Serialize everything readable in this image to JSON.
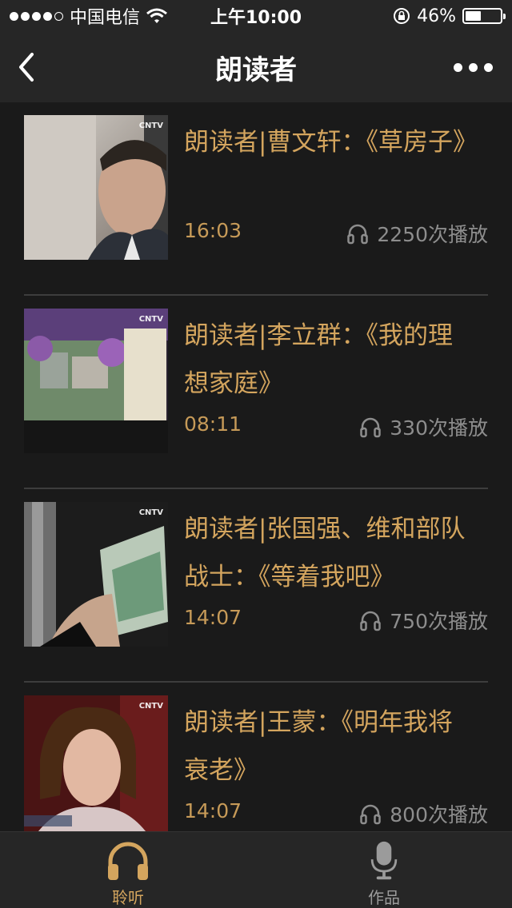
{
  "status_bar": {
    "carrier": "中国电信",
    "time": "上午10:00",
    "battery_percent": "46%",
    "battery_level": 0.46,
    "signal_bars_filled": 4,
    "signal_bars_total": 5
  },
  "nav": {
    "title": "朗读者",
    "back_icon": "chevron-left-icon",
    "more_icon": "more-dots-icon"
  },
  "items": [
    {
      "title": "朗读者|曹文轩：《草房子》",
      "duration": "16:03",
      "plays": "2250次播放",
      "thumb_watermark": "CNTV"
    },
    {
      "title": "朗读者|李立群：《我的理想家庭》",
      "duration": "08:11",
      "plays": "330次播放",
      "thumb_watermark": "CNTV"
    },
    {
      "title": "朗读者|张国强、维和部队战士：《等着我吧》",
      "duration": "14:07",
      "plays": "750次播放",
      "thumb_watermark": "CNTV"
    },
    {
      "title": "朗读者|王蒙：《明年我将衰老》",
      "duration": "14:07",
      "plays": "800次播放",
      "thumb_watermark": "CNTV"
    }
  ],
  "tabs": [
    {
      "label": "聆听",
      "icon": "headphones-icon",
      "active": true
    },
    {
      "label": "作品",
      "icon": "microphone-icon",
      "active": false
    }
  ],
  "colors": {
    "accent": "#d4a55e",
    "background": "#1a1a1a",
    "bar_background": "#262626",
    "muted_text": "#8d8d8d"
  }
}
